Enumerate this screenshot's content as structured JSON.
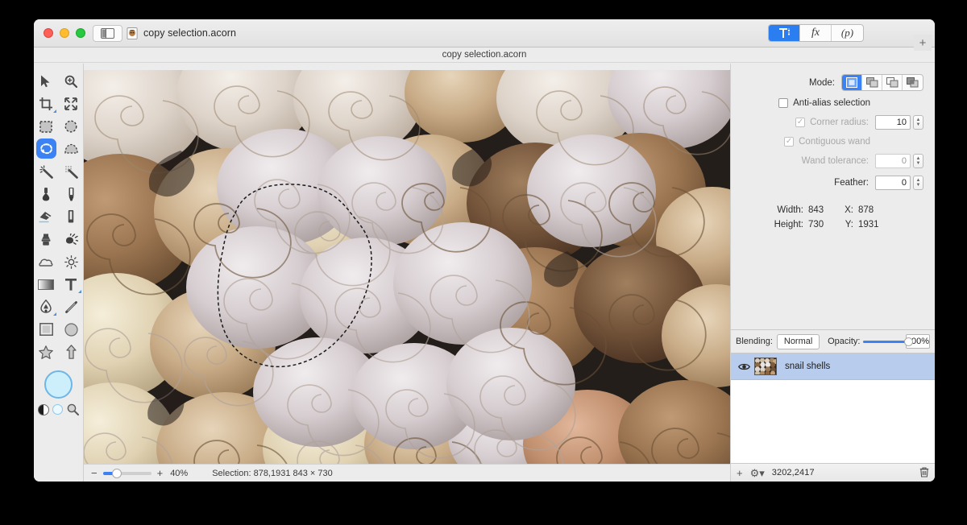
{
  "window": {
    "title": "copy selection.acorn",
    "doc_strip_title": "copy selection.acorn",
    "traffic_lights": [
      "close",
      "minimize",
      "maximize"
    ],
    "sidebar_toggle_icon": "sidebar-toggle-icon",
    "doc_icon": "acorn-document-icon"
  },
  "inspector_segments": [
    {
      "icon": "tool-options-icon",
      "label": "",
      "active": true
    },
    {
      "icon": "fx-icon",
      "label": "fx",
      "active": false
    },
    {
      "icon": "palette-icon",
      "label": "(p)",
      "active": false
    }
  ],
  "add_inspector_button": "+",
  "tools": [
    {
      "name": "move-tool",
      "icon": "arrow-cursor-icon",
      "selected": false,
      "has_corner": false
    },
    {
      "name": "zoom-tool",
      "icon": "magnifier-plus-icon",
      "selected": false,
      "has_corner": false
    },
    {
      "name": "crop-tool",
      "icon": "crop-icon",
      "selected": false,
      "has_corner": true
    },
    {
      "name": "transform-tool",
      "icon": "move-arrows-icon",
      "selected": false,
      "has_corner": false
    },
    {
      "name": "rect-select-tool",
      "icon": "rectangular-marquee-icon",
      "selected": false,
      "has_corner": false
    },
    {
      "name": "ellipse-select-tool",
      "icon": "elliptical-marquee-icon",
      "selected": false,
      "has_corner": false
    },
    {
      "name": "lasso-tool",
      "icon": "lasso-icon",
      "selected": true,
      "has_corner": false
    },
    {
      "name": "polygon-lasso-tool",
      "icon": "polygonal-lasso-icon",
      "selected": false,
      "has_corner": false
    },
    {
      "name": "magic-wand-tool",
      "icon": "magic-wand-icon",
      "selected": false,
      "has_corner": false
    },
    {
      "name": "instant-alpha-tool",
      "icon": "instant-alpha-icon",
      "selected": false,
      "has_corner": false
    },
    {
      "name": "paint-bucket-tool",
      "icon": "paint-bucket-icon",
      "selected": false,
      "has_corner": false
    },
    {
      "name": "brush-tool",
      "icon": "paintbrush-icon",
      "selected": false,
      "has_corner": false
    },
    {
      "name": "eraser-tool",
      "icon": "eraser-icon",
      "selected": false,
      "has_corner": false
    },
    {
      "name": "pencil-tool",
      "icon": "pencil-tool-icon",
      "selected": false,
      "has_corner": false
    },
    {
      "name": "clone-stamp-tool",
      "icon": "clone-stamp-icon",
      "selected": false,
      "has_corner": false
    },
    {
      "name": "smudge-tool",
      "icon": "smudge-icon",
      "selected": false,
      "has_corner": false
    },
    {
      "name": "blur-tool",
      "icon": "cloud-blur-icon",
      "selected": false,
      "has_corner": false
    },
    {
      "name": "dodge-tool",
      "icon": "sun-dodge-icon",
      "selected": false,
      "has_corner": false
    },
    {
      "name": "gradient-tool",
      "icon": "gradient-icon",
      "selected": false,
      "has_corner": false
    },
    {
      "name": "text-tool",
      "icon": "text-t-icon",
      "selected": false,
      "has_corner": true
    },
    {
      "name": "bezier-pen-tool",
      "icon": "bezier-pen-icon",
      "selected": false,
      "has_corner": true
    },
    {
      "name": "line-tool",
      "icon": "line-icon",
      "selected": false,
      "has_corner": false
    },
    {
      "name": "rectangle-shape-tool",
      "icon": "rectangle-shape-icon",
      "selected": false,
      "has_corner": false
    },
    {
      "name": "ellipse-shape-tool",
      "icon": "ellipse-shape-icon",
      "selected": false,
      "has_corner": false
    },
    {
      "name": "star-shape-tool",
      "icon": "star-shape-icon",
      "selected": false,
      "has_corner": false
    },
    {
      "name": "arrow-shape-tool",
      "icon": "arrow-shape-icon",
      "selected": false,
      "has_corner": false
    }
  ],
  "color_well": {
    "foreground_color": "#cdeffc",
    "border_color": "#6db6e8",
    "swap_icon": "black-white-swap-icon",
    "reset_icon": "default-colors-icon",
    "picker_icon": "color-picker-magnifier-icon"
  },
  "tool_options": {
    "mode_label": "Mode:",
    "modes": [
      {
        "name": "new-selection",
        "icon": "new-selection-icon",
        "active": true
      },
      {
        "name": "add-selection",
        "icon": "add-selection-icon",
        "active": false
      },
      {
        "name": "subtract-selection",
        "icon": "subtract-selection-icon",
        "active": false
      },
      {
        "name": "intersect-selection",
        "icon": "intersect-selection-icon",
        "active": false
      }
    ],
    "antialias_label": "Anti-alias selection",
    "antialias_checked": false,
    "corner_radius_label": "Corner radius:",
    "corner_radius_checked": true,
    "corner_radius_value": "10",
    "contiguous_wand_label": "Contiguous wand",
    "contiguous_wand_checked": true,
    "wand_tolerance_label": "Wand tolerance:",
    "wand_tolerance_value": "0",
    "feather_label": "Feather:",
    "feather_value": "0"
  },
  "dimensions": {
    "width_label": "Width:",
    "width_value": "843",
    "height_label": "Height:",
    "height_value": "730",
    "x_label": "X:",
    "x_value": "878",
    "y_label": "Y:",
    "y_value": "1931"
  },
  "layers": {
    "blending_label": "Blending:",
    "blending_value": "Normal",
    "opacity_label": "Opacity:",
    "opacity_value": "100%",
    "rows": [
      {
        "name": "snail shells",
        "visible": true,
        "selected": true
      }
    ],
    "footer": {
      "add_icon": "add-layer-icon",
      "settings_icon": "gear-dropdown-icon",
      "doc_size": "3202,2417",
      "delete_icon": "trash-icon"
    }
  },
  "status_bar": {
    "zoom_minus": "−",
    "zoom_plus": "+",
    "zoom_value": "40%",
    "selection_info": "Selection: 878,1931 843 × 730"
  },
  "colors": {
    "accent": "#3b82f5",
    "window_chrome": "#ececec",
    "layer_selected": "#b8ccee",
    "canvas_backdrop": "#2c2723"
  }
}
